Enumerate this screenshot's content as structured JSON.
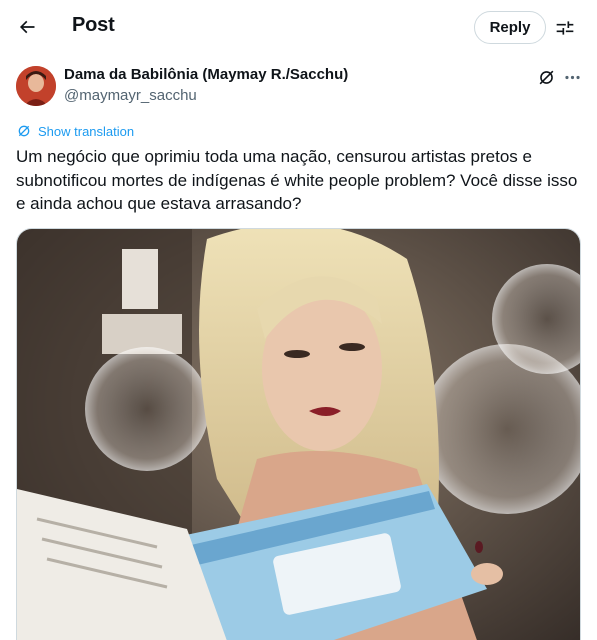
{
  "header": {
    "title": "Post",
    "reply_label": "Reply"
  },
  "icons": {
    "back": "arrow-left-icon",
    "settings": "sliders-icon",
    "grok": "grok-icon",
    "more": "more-horizontal-icon",
    "translate": "translate-icon"
  },
  "author": {
    "display_name": "Dama da Babilônia (Maymay R./Sacchu)",
    "handle": "@maymayr_sacchu"
  },
  "post": {
    "translate_label": "Show translation",
    "text": "Um negócio que oprimiu toda uma nação, censurou artistas pretos e subnotificou mortes de indígenas é white people problem? Você disse isso e ainda achou que estava arrasando?"
  },
  "colors": {
    "accent": "#1d9bf0",
    "text": "#0f1419",
    "secondary": "#536471",
    "border": "#cfd9de"
  }
}
